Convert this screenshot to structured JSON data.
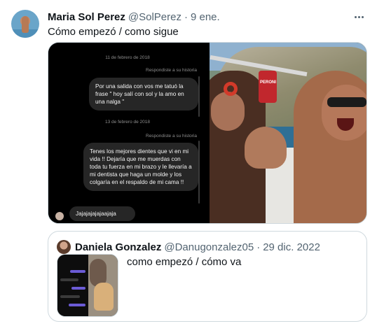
{
  "tweet": {
    "author_name": "Maria Sol Perez",
    "author_handle": "@SolPerez",
    "separator": "·",
    "date": "9 ene.",
    "text": "Cómo empezó / como sigue",
    "more_icon": "more-horizontal-icon"
  },
  "media": {
    "chat": {
      "date1": "11 de febrero de 2018",
      "reply1": "Respondiste a su historia",
      "message1": "Por una salida con vos me tatuó la frase \" hoy salí con sol y la amo en una nalga \"",
      "date2": "13 de febrero de 2018",
      "reply2": "Respondiste a su historia",
      "message2": "Tenes los mejores dientes que vi en mi vida !! Dejaría que me muerdas con toda tu fuerza en mi brazo y le llevaría a mi dentista que haga un molde y los colgaría en el respaldo de mi cama !!",
      "message3": "Jajajajajajaajaja"
    },
    "photo": {
      "can_label": "PERONI"
    }
  },
  "quote": {
    "author_name": "Daniela Gonzalez",
    "author_handle": "@Danugonzalez05",
    "separator": "·",
    "date": "29 dic. 2022",
    "text": "como empezó / cómo va"
  },
  "colors": {
    "text_primary": "#0f1419",
    "text_secondary": "#536471",
    "border": "#cfd9de",
    "chat_bg": "#000000",
    "bubble_bg": "#262626"
  }
}
